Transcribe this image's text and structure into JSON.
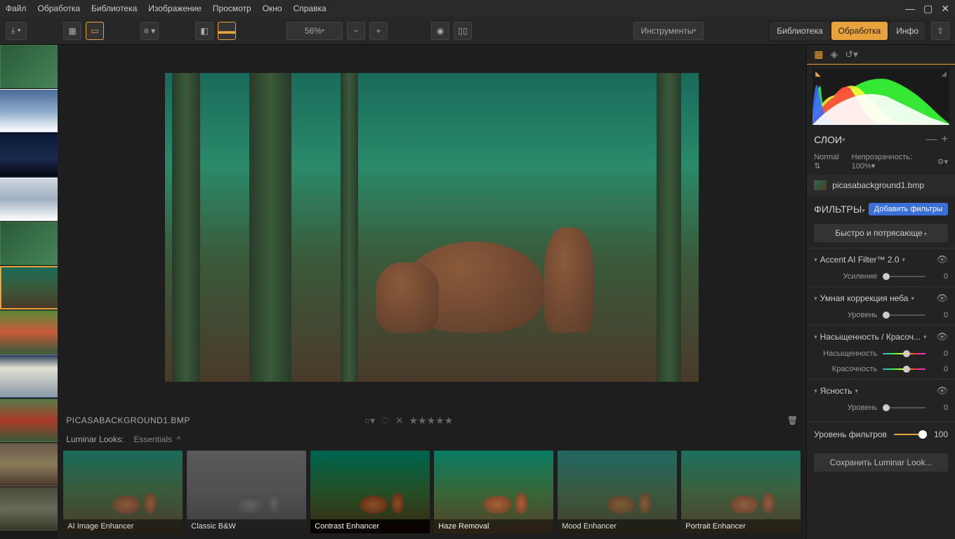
{
  "menu": {
    "file": "Файл",
    "edit": "Обработка",
    "library": "Библиотека",
    "image": "Изображение",
    "view": "Просмотр",
    "window": "Окно",
    "help": "Справка"
  },
  "toolbar": {
    "zoom": "56%",
    "tools": "Инструменты"
  },
  "mode_tabs": {
    "library": "Библиотека",
    "edit": "Обработка",
    "info": "Инфо"
  },
  "filename_upper": "PICASABACKGROUND1.BMP",
  "looks": {
    "label": "Luminar Looks:",
    "category": "Essentials",
    "items": [
      "AI Image Enhancer",
      "Classic B&W",
      "Contrast Enhancer",
      "Haze Removal",
      "Mood Enhancer",
      "Portrait Enhancer"
    ]
  },
  "panel": {
    "layers_title": "СЛОИ",
    "blend_mode": "Normal",
    "opacity_label": "Непрозрачность:",
    "opacity_value": "100%",
    "layer_name": "picasabackground1.bmp",
    "filters_title": "ФИЛЬТРЫ",
    "add_filters": "Добавить фильтры",
    "preset": "Быстро и потрясающе",
    "f1_title": "Accent AI Filter™ 2.0",
    "f1_param": "Усиление",
    "f1_val": "0",
    "f2_title": "Умная коррекция неба",
    "f2_param": "Уровень",
    "f2_val": "0",
    "f3_title": "Насыщенность / Красоч...",
    "f3_p1": "Насыщенность",
    "f3_v1": "0",
    "f3_p2": "Красочность",
    "f3_v2": "0",
    "f4_title": "Ясность",
    "f4_param": "Уровень",
    "f4_val": "0",
    "amount_label": "Уровень фильтров",
    "amount_val": "100",
    "save": "Сохранить Luminar Look..."
  }
}
